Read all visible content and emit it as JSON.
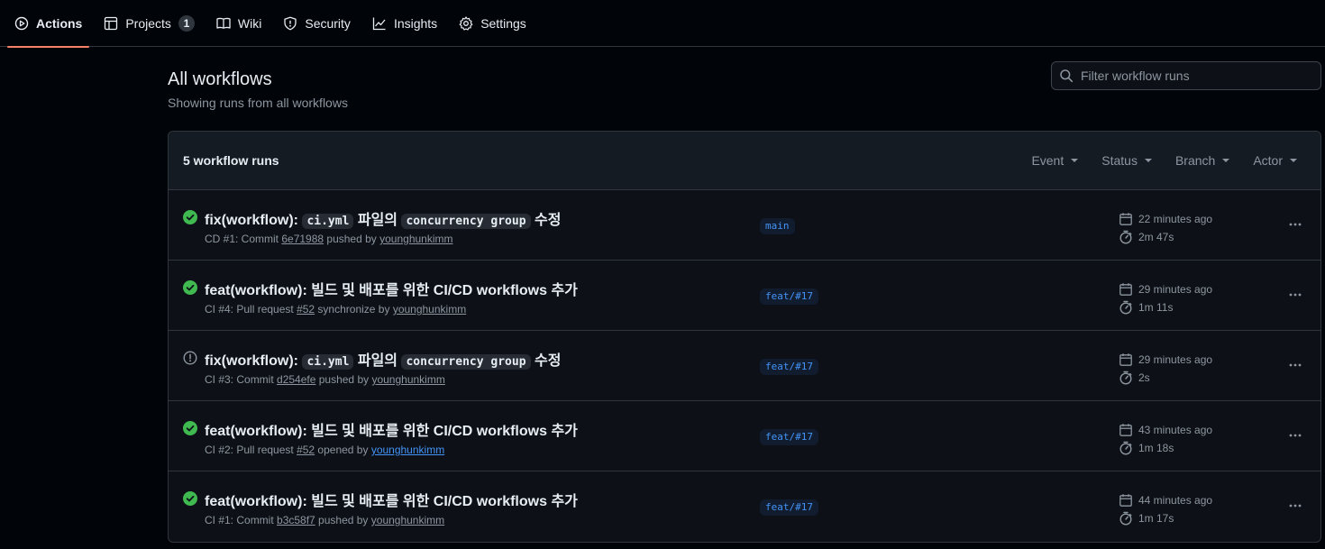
{
  "nav": {
    "tabs": [
      {
        "label": "Actions",
        "icon": "play-icon"
      },
      {
        "label": "Projects",
        "icon": "table-icon",
        "counter": "1"
      },
      {
        "label": "Wiki",
        "icon": "book-icon"
      },
      {
        "label": "Security",
        "icon": "shield-icon"
      },
      {
        "label": "Insights",
        "icon": "graph-icon"
      },
      {
        "label": "Settings",
        "icon": "gear-icon"
      }
    ],
    "active_tab": "Actions"
  },
  "page": {
    "title": "All workflows",
    "subtitle": "Showing runs from all workflows",
    "filter_placeholder": "Filter workflow runs"
  },
  "runs": {
    "count_label": "5 workflow runs",
    "filters": [
      "Event",
      "Status",
      "Branch",
      "Actor"
    ],
    "items": [
      {
        "status": "success",
        "title_parts": [
          {
            "text": "fix(workflow): ",
            "code": false
          },
          {
            "text": "ci.yml",
            "code": true
          },
          {
            "text": " 파일의 ",
            "code": false
          },
          {
            "text": "concurrency group",
            "code": true
          },
          {
            "text": " 수정",
            "code": false
          }
        ],
        "meta": {
          "prefix": "CD #1: Commit ",
          "ref": "6e71988",
          "middle": " pushed by ",
          "actor": "younghunkimm"
        },
        "branch": "main",
        "time_ago": "22 minutes ago",
        "duration": "2m 47s"
      },
      {
        "status": "success",
        "title_parts": [
          {
            "text": "feat(workflow): 빌드 및 배포를 위한 CI/CD workflows 추가",
            "code": false
          }
        ],
        "meta": {
          "prefix": "CI #4: Pull request ",
          "ref": "#52",
          "middle": " synchronize by ",
          "actor": "younghunkimm"
        },
        "branch": "feat/#17",
        "time_ago": "29 minutes ago",
        "duration": "1m 11s"
      },
      {
        "status": "warning",
        "title_parts": [
          {
            "text": "fix(workflow): ",
            "code": false
          },
          {
            "text": "ci.yml",
            "code": true
          },
          {
            "text": " 파일의 ",
            "code": false
          },
          {
            "text": "concurrency group",
            "code": true
          },
          {
            "text": " 수정",
            "code": false
          }
        ],
        "meta": {
          "prefix": "CI #3: Commit ",
          "ref": "d254efe",
          "middle": " pushed by ",
          "actor": "younghunkimm"
        },
        "branch": "feat/#17",
        "time_ago": "29 minutes ago",
        "duration": "2s"
      },
      {
        "status": "success",
        "title_parts": [
          {
            "text": "feat(workflow): 빌드 및 배포를 위한 CI/CD workflows 추가",
            "code": false
          }
        ],
        "meta": {
          "prefix": "CI #2: Pull request ",
          "ref": "#52",
          "middle": " opened by ",
          "actor": "younghunkimm",
          "actor_highlight": true
        },
        "branch": "feat/#17",
        "time_ago": "43 minutes ago",
        "duration": "1m 18s"
      },
      {
        "status": "success",
        "title_parts": [
          {
            "text": "feat(workflow): 빌드 및 배포를 위한 CI/CD workflows 추가",
            "code": false
          }
        ],
        "meta": {
          "prefix": "CI #1: Commit ",
          "ref": "b3c58f7",
          "middle": " pushed by ",
          "actor": "younghunkimm"
        },
        "branch": "feat/#17",
        "time_ago": "44 minutes ago",
        "duration": "1m 17s"
      }
    ]
  },
  "colors": {
    "success": "#3fb950",
    "warning": "#8d96a0",
    "accent_underline": "#f78166",
    "link": "#4493f8"
  }
}
